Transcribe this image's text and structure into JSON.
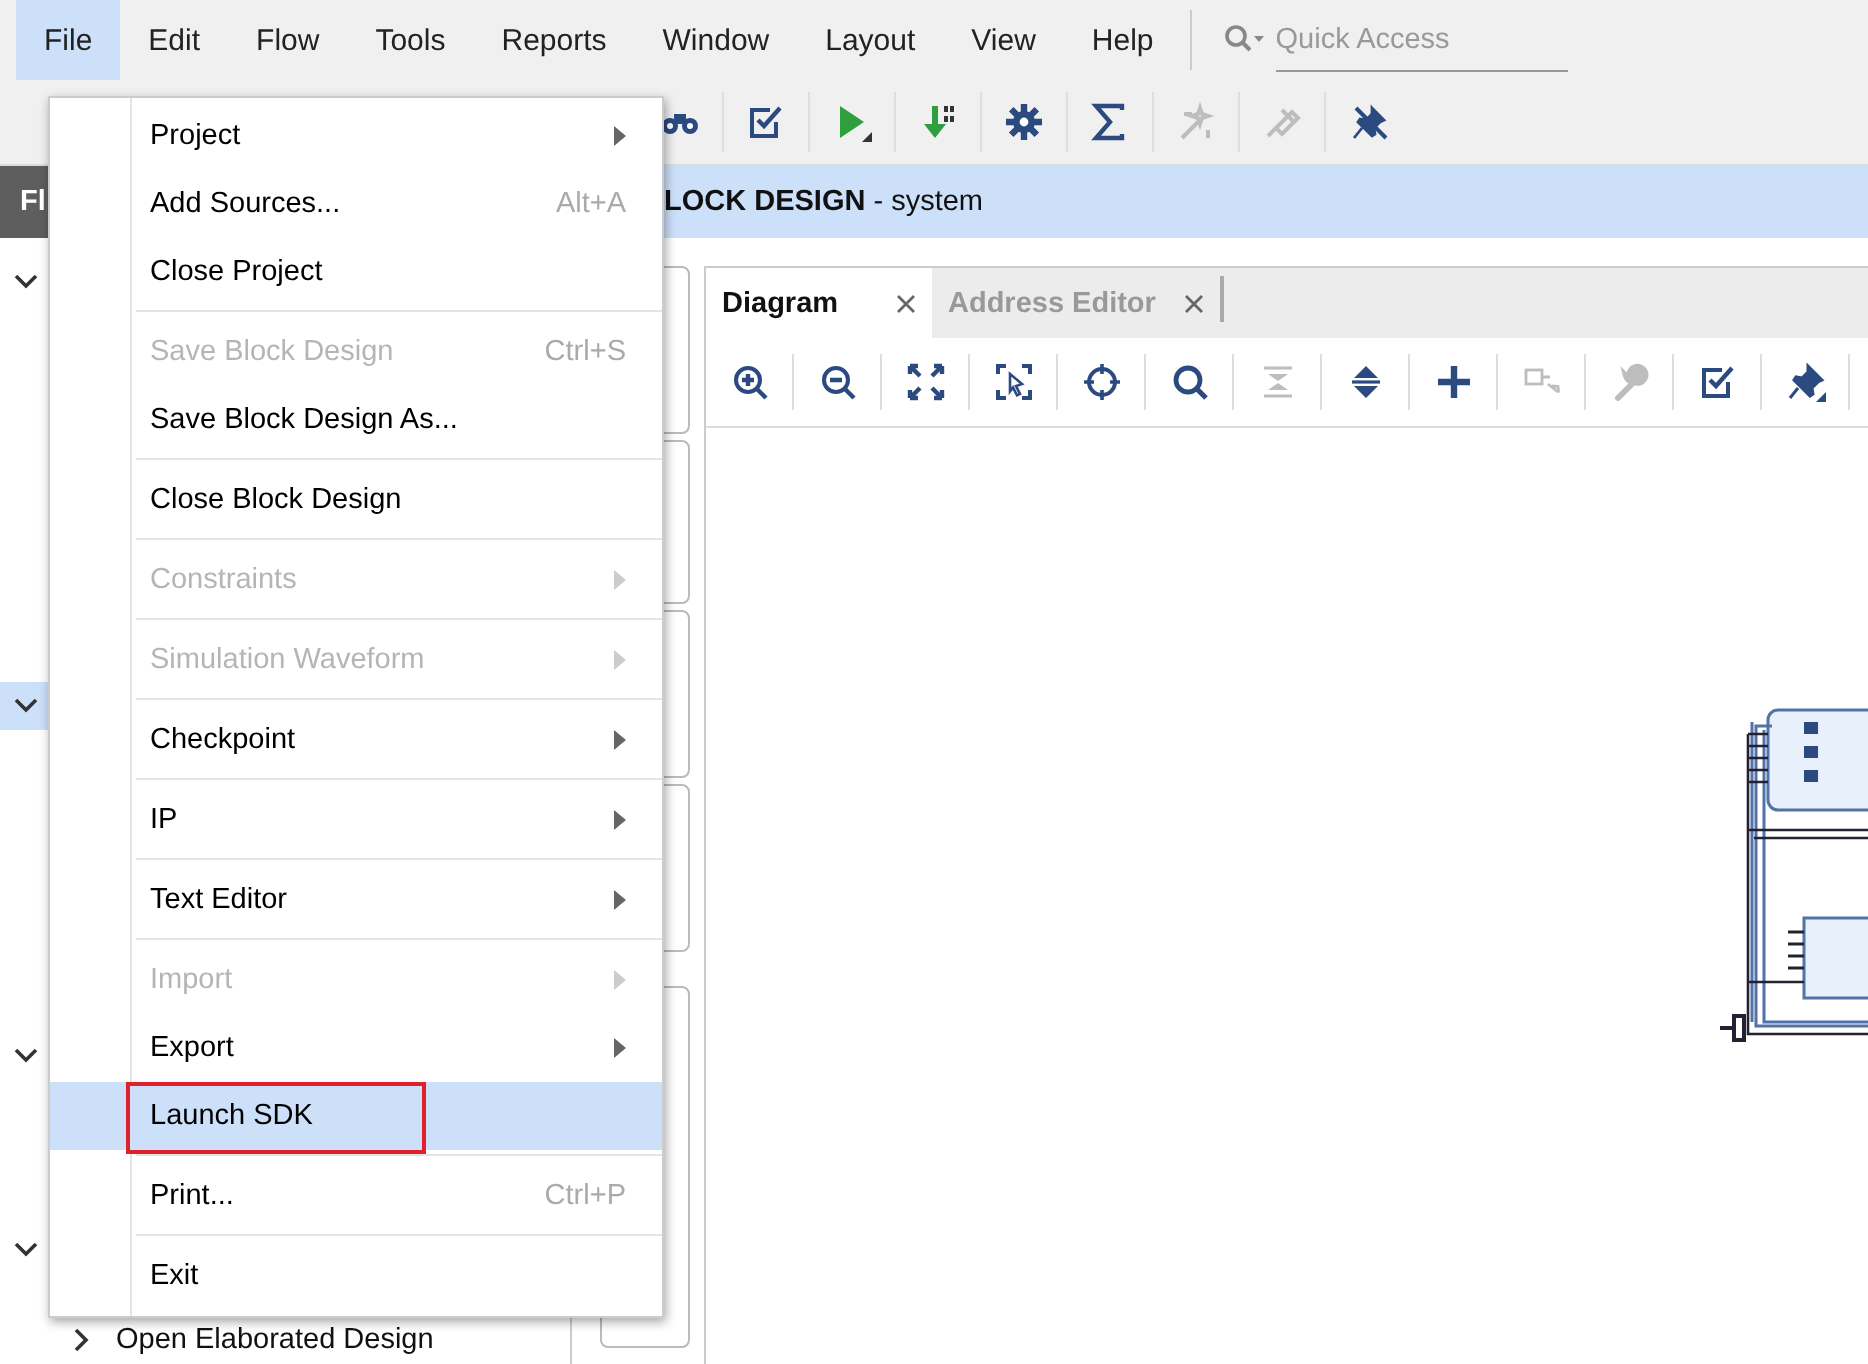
{
  "menubar": [
    {
      "label": "File",
      "selected": true
    },
    {
      "label": "Edit",
      "selected": false
    },
    {
      "label": "Flow",
      "selected": false
    },
    {
      "label": "Tools",
      "selected": false
    },
    {
      "label": "Reports",
      "selected": false
    },
    {
      "label": "Window",
      "selected": false
    },
    {
      "label": "Layout",
      "selected": false
    },
    {
      "label": "View",
      "selected": false
    },
    {
      "label": "Help",
      "selected": false
    }
  ],
  "quick_access": {
    "placeholder": "Quick Access"
  },
  "toolbar": [
    {
      "kind": "binoculars",
      "disabled": false
    },
    {
      "kind": "checkbox",
      "disabled": false
    },
    {
      "kind": "run",
      "disabled": false
    },
    {
      "kind": "program",
      "disabled": false
    },
    {
      "kind": "gear",
      "disabled": false
    },
    {
      "kind": "sigma",
      "disabled": false
    },
    {
      "kind": "wand",
      "disabled": true
    },
    {
      "kind": "probe",
      "disabled": true
    },
    {
      "kind": "pin-off",
      "disabled": false
    }
  ],
  "navigator": {
    "title": "Fl",
    "sections": [
      {
        "expanded": true,
        "selected": false
      },
      {
        "expanded": true,
        "selected": true
      },
      {
        "expanded": true,
        "selected": false
      },
      {
        "expanded": true,
        "selected": false
      }
    ],
    "items": [
      {
        "label": "Open Elaborated Design",
        "expanded": false
      }
    ]
  },
  "header": {
    "title": "**LOCK DESIGN** - system"
  },
  "editor": {
    "tabs": [
      {
        "label": "Diagram",
        "selected": true
      },
      {
        "label": "Address Editor",
        "selected": false
      }
    ],
    "toolbar": [
      {
        "kind": "zoom-in",
        "disabled": false
      },
      {
        "kind": "zoom-out",
        "disabled": false
      },
      {
        "kind": "fit",
        "disabled": false
      },
      {
        "kind": "select-area",
        "disabled": false
      },
      {
        "kind": "crosshair",
        "disabled": false
      },
      {
        "kind": "search",
        "disabled": false
      },
      {
        "kind": "collapse",
        "disabled": true
      },
      {
        "kind": "expand",
        "disabled": false
      },
      {
        "kind": "plus",
        "disabled": false
      },
      {
        "kind": "port",
        "disabled": true
      },
      {
        "kind": "wrench",
        "disabled": true
      },
      {
        "kind": "checkbox",
        "disabled": false
      },
      {
        "kind": "pin",
        "disabled": false
      }
    ]
  },
  "file_menu": {
    "groups": [
      [
        {
          "label": "Project",
          "submenu": true,
          "disabled": false,
          "selected": false,
          "outlined": false
        },
        {
          "label": "Add Sources...",
          "shortcut": "Alt+A",
          "submenu": false,
          "disabled": false,
          "selected": false,
          "outlined": false
        },
        {
          "label": "Close Project",
          "submenu": false,
          "disabled": false,
          "selected": false,
          "outlined": false
        }
      ],
      [
        {
          "label": "Save Block Design",
          "shortcut": "Ctrl+S",
          "submenu": false,
          "disabled": true,
          "selected": false,
          "outlined": false
        },
        {
          "label": "Save Block Design As...",
          "submenu": false,
          "disabled": false,
          "selected": false,
          "outlined": false
        }
      ],
      [
        {
          "label": "Close Block Design",
          "submenu": false,
          "disabled": false,
          "selected": false,
          "outlined": false
        }
      ],
      [
        {
          "label": "Constraints",
          "submenu": true,
          "disabled": true,
          "selected": false,
          "outlined": false
        }
      ],
      [
        {
          "label": "Simulation Waveform",
          "submenu": true,
          "disabled": true,
          "selected": false,
          "outlined": false
        }
      ],
      [
        {
          "label": "Checkpoint",
          "submenu": true,
          "disabled": false,
          "selected": false,
          "outlined": false
        }
      ],
      [
        {
          "label": "IP",
          "submenu": true,
          "disabled": false,
          "selected": false,
          "outlined": false
        }
      ],
      [
        {
          "label": "Text Editor",
          "submenu": true,
          "disabled": false,
          "selected": false,
          "outlined": false
        }
      ],
      [
        {
          "label": "Import",
          "submenu": true,
          "disabled": true,
          "selected": false,
          "outlined": false
        },
        {
          "label": "Export",
          "submenu": true,
          "disabled": false,
          "selected": false,
          "outlined": false
        },
        {
          "label": "Launch SDK",
          "submenu": false,
          "disabled": false,
          "selected": true,
          "outlined": true
        }
      ],
      [
        {
          "label": "Print...",
          "shortcut": "Ctrl+P",
          "submenu": false,
          "disabled": false,
          "selected": false,
          "outlined": false
        }
      ],
      [
        {
          "label": "Exit",
          "submenu": false,
          "disabled": false,
          "selected": false,
          "outlined": false
        }
      ]
    ]
  }
}
